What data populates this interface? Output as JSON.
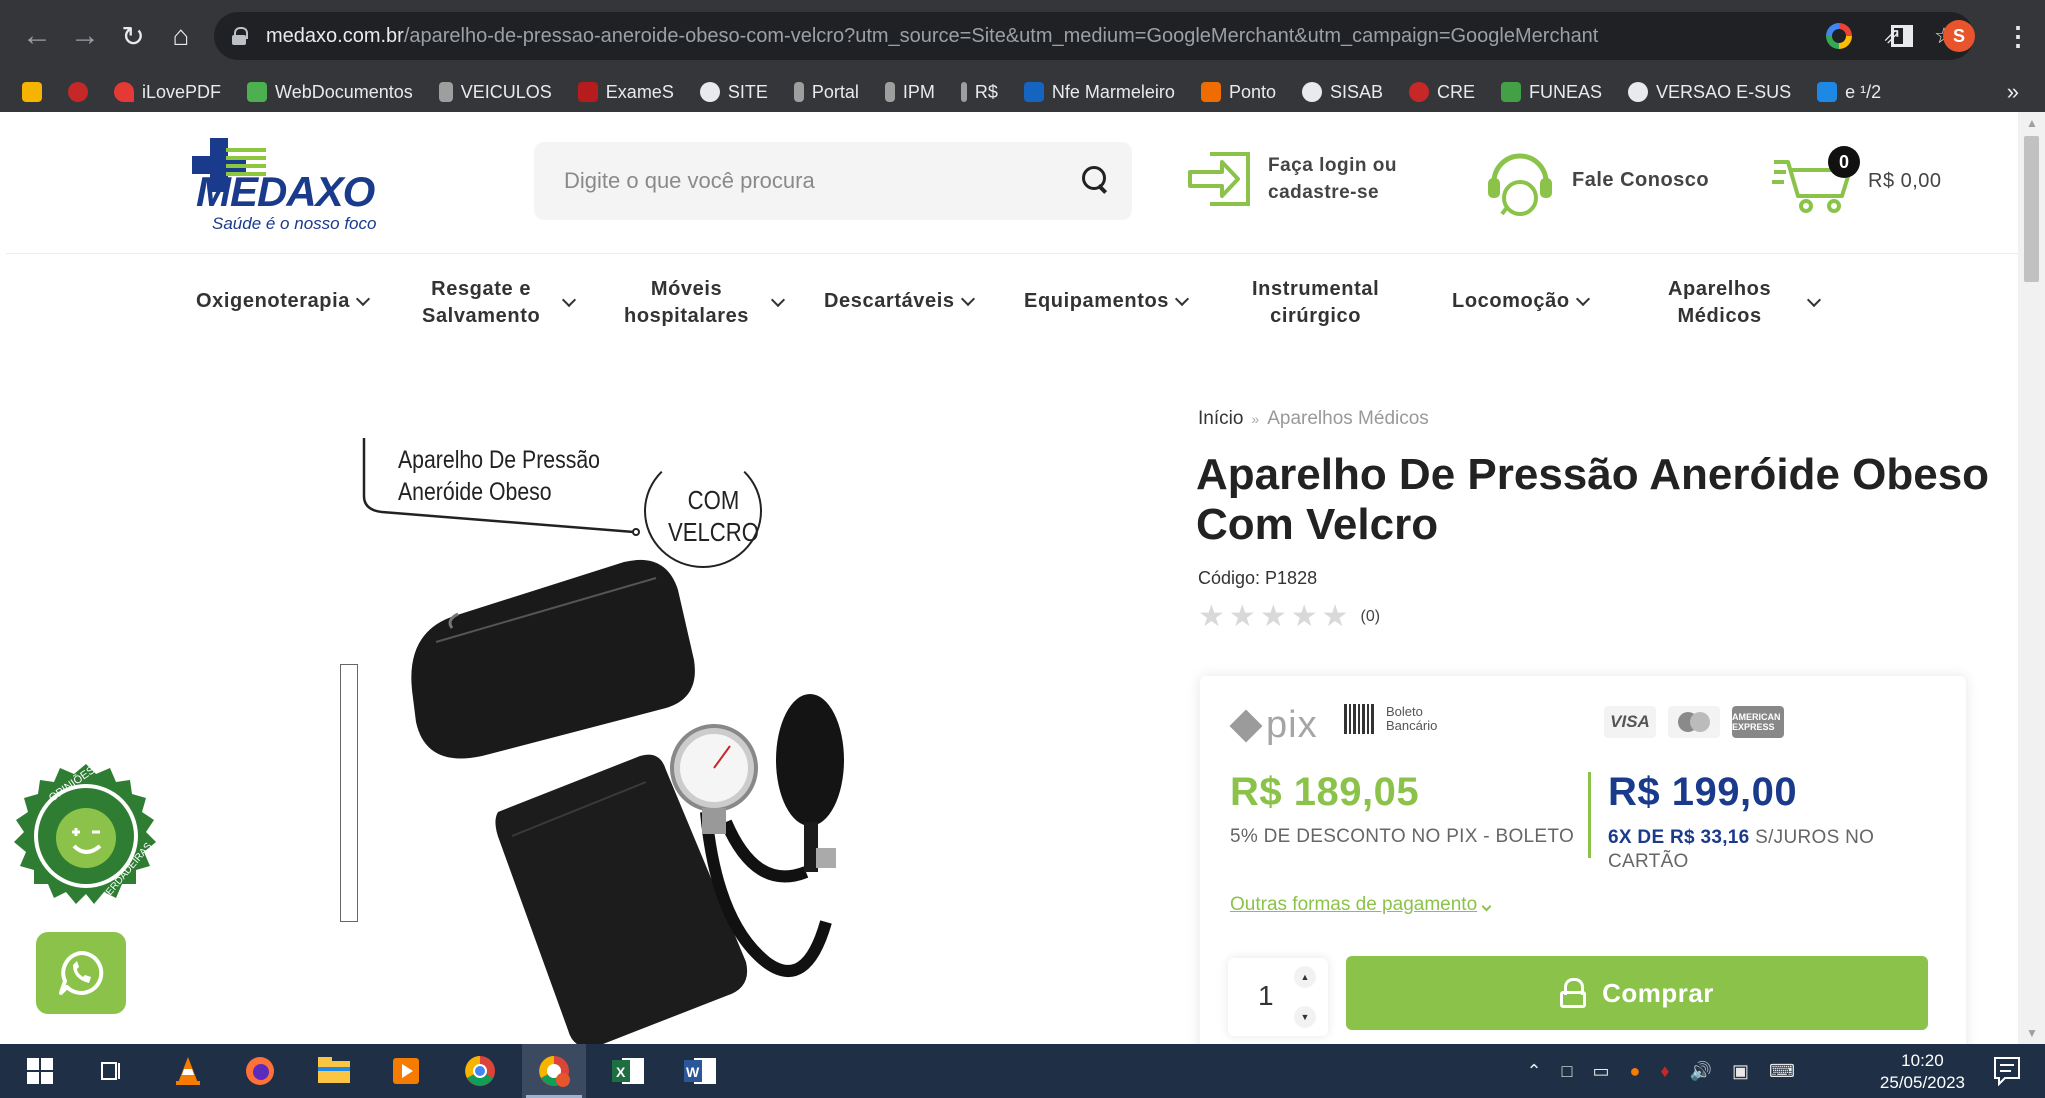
{
  "browser": {
    "url_host": "medaxo.com.br",
    "url_path": "/aparelho-de-pressao-aneroide-obeso-com-velcro?utm_source=Site&utm_medium=GoogleMerchant&utm_campaign=GoogleMerchant",
    "profile_initial": "S",
    "bookmarks": [
      "iLovePDF",
      "WebDocumentos",
      "VEICULOS",
      "ExameS",
      "SITE",
      "Portal",
      "IPM",
      "R$",
      "Nfe Marmeleiro",
      "Ponto",
      "SISAB",
      "CRE",
      "FUNEAS",
      "VERSAO E-SUS",
      "e ¹/2"
    ],
    "bookmark_more": "»"
  },
  "header": {
    "logo_word": "MEDAXO",
    "logo_tagline": "Saúde é o nosso foco",
    "search_placeholder": "Digite o que você procura",
    "login_line1": "Faça login ou",
    "login_line2": "cadastre-se",
    "contact_label": "Fale Conosco",
    "cart_count": "0",
    "cart_total": "R$ 0,00"
  },
  "menu": {
    "items": [
      {
        "line1": "Oxigenoterapia",
        "line2": ""
      },
      {
        "line1": "Resgate e",
        "line2": "Salvamento"
      },
      {
        "line1": "Móveis",
        "line2": "hospitalares"
      },
      {
        "line1": "Descartáveis",
        "line2": ""
      },
      {
        "line1": "Equipamentos",
        "line2": ""
      },
      {
        "line1": "Instrumental",
        "line2": "cirúrgico"
      },
      {
        "line1": "Locomoção",
        "line2": ""
      },
      {
        "line1": "Aparelhos",
        "line2": "Médicos"
      }
    ]
  },
  "product_image": {
    "caption_line1": "Aparelho De Pressão",
    "caption_line2": "Aneróide Obeso",
    "badge_line1": "COM",
    "badge_line2": "VELCRO"
  },
  "product": {
    "breadcrumb_home": "Início",
    "breadcrumb_sep": "»",
    "breadcrumb_current": "Aparelhos Médicos",
    "title": "Aparelho De Pressão Aneróide Obeso Com Velcro",
    "code": "Código: P1828",
    "rating_count": "(0)",
    "rating_stars": 0
  },
  "pricing": {
    "pix_label": "pix",
    "boleto_line1": "Boleto",
    "boleto_line2": "Bancário",
    "card_visa": "VISA",
    "card_amex": "AMERICAN EXPRESS",
    "pix_price": "R$ 189,05",
    "pix_note": "5% DE DESCONTO NO PIX - BOLETO",
    "full_price": "R$ 199,00",
    "install_bold": "6X DE R$ 33,16",
    "install_rest": " S/JUROS NO CARTÃO",
    "other_payments": "Outras formas de pagamento",
    "quantity": "1",
    "buy_label": "Comprar"
  },
  "badges": {
    "reviews_top": "OPINIÕES",
    "reviews_bottom": "VERDADEIRAS"
  },
  "taskbar": {
    "time": "10:20",
    "date": "25/05/2023"
  },
  "colors": {
    "brand_blue": "#1a3a8c",
    "brand_green": "#8bc34a",
    "chrome_dark": "#35363a",
    "taskbar": "#1f2f45"
  }
}
